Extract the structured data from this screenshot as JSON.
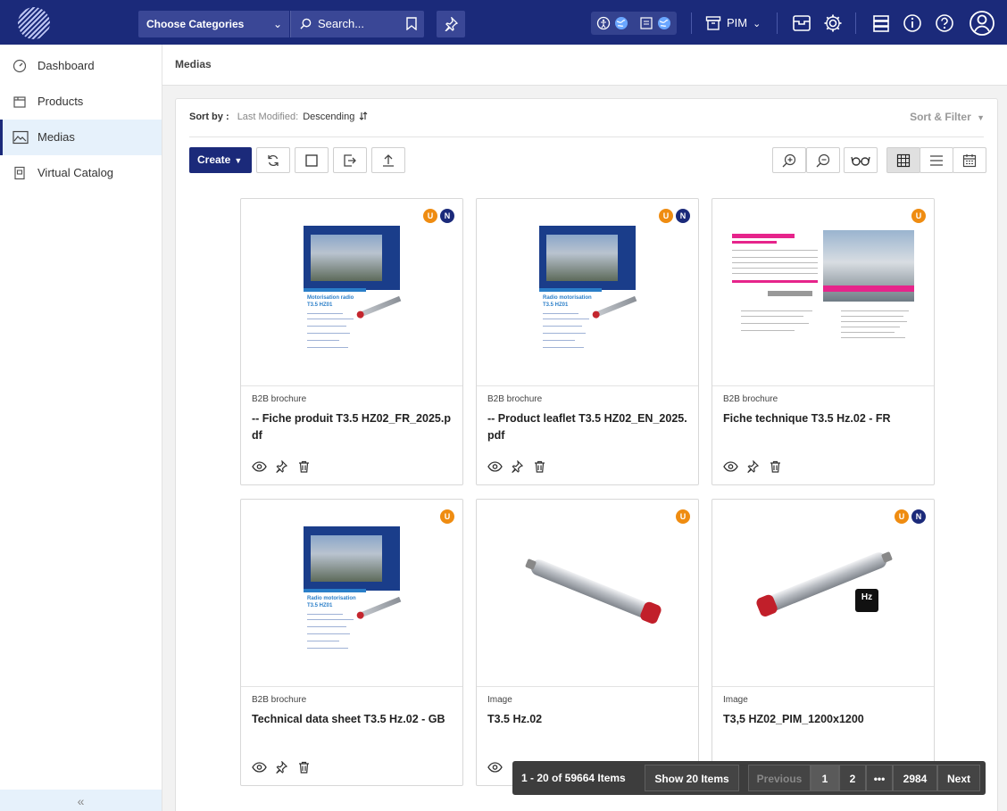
{
  "topbar": {
    "category_select": "Choose Categories",
    "search_placeholder": "Search...",
    "module_label": "PIM"
  },
  "sidebar": {
    "items": [
      {
        "label": "Dashboard",
        "icon": "dashboard-icon"
      },
      {
        "label": "Products",
        "icon": "products-icon"
      },
      {
        "label": "Medias",
        "icon": "medias-icon",
        "active": true
      },
      {
        "label": "Virtual Catalog",
        "icon": "virtual-catalog-icon"
      }
    ],
    "collapse_label": "«"
  },
  "page": {
    "title": "Medias"
  },
  "sort": {
    "label": "Sort by :",
    "field": "Last Modified:",
    "direction": "Descending",
    "sort_filter": "Sort & Filter"
  },
  "toolbar": {
    "create_label": "Create"
  },
  "cards": [
    {
      "type": "B2B brochure",
      "name": "-- Fiche produit T3.5 HZ02_FR_2025.pdf",
      "badges": [
        "U",
        "N"
      ],
      "thumb": "brochure",
      "thumb_title1": "Motorisation radio",
      "thumb_title2": "T3.5 HZ01"
    },
    {
      "type": "B2B brochure",
      "name": "-- Product leaflet T3.5 HZ02_EN_2025.pdf",
      "badges": [
        "U",
        "N"
      ],
      "thumb": "brochure",
      "thumb_title1": "Radio motorisation",
      "thumb_title2": "T3.5 HZ01"
    },
    {
      "type": "B2B brochure",
      "name": "Fiche technique T3.5 Hz.02 - FR",
      "badges": [
        "U"
      ],
      "thumb": "techsheet"
    },
    {
      "type": "B2B brochure",
      "name": "Technical data sheet T3.5 Hz.02 - GB",
      "badges": [
        "U"
      ],
      "thumb": "brochure",
      "thumb_title1": "Radio motorisation",
      "thumb_title2": "T3.5 HZ01"
    },
    {
      "type": "Image",
      "name": "T3.5 Hz.02",
      "badges": [
        "U"
      ],
      "thumb": "motor"
    },
    {
      "type": "Image",
      "name": "T3,5 HZ02_PIM_1200x1200",
      "badges": [
        "U",
        "N"
      ],
      "thumb": "motor-hz",
      "hz_logo": "Hz"
    }
  ],
  "pagination": {
    "count": "1 - 20 of 59664 Items",
    "show": "Show 20 Items",
    "previous": "Previous",
    "pages": [
      "1",
      "2",
      "•••",
      "2984"
    ],
    "next": "Next"
  },
  "colors": {
    "brand": "#1b2a7a",
    "badge_u": "#ef8c11",
    "badge_n": "#1b2a7a"
  }
}
